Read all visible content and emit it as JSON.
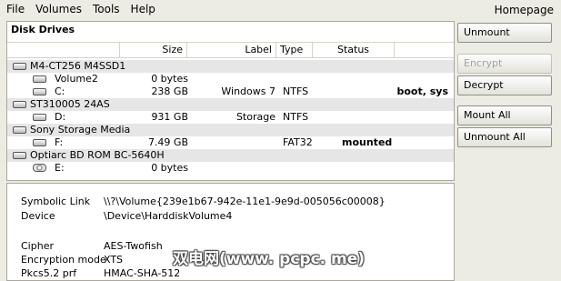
{
  "menubar": {
    "file": "File",
    "volumes": "Volumes",
    "tools": "Tools",
    "help": "Help",
    "homepage": "Homepage"
  },
  "drives": {
    "title": "Disk Drives",
    "columns": {
      "size": "Size",
      "label": "Label",
      "type": "Type",
      "status": "Status"
    },
    "rows": [
      {
        "kind": "disk",
        "name": "M4-CT256 M4SSD1",
        "size": "",
        "label": "",
        "type": "",
        "status": "",
        "extra": "",
        "icon": "harddisk-icon"
      },
      {
        "kind": "vol",
        "name": "Volume2",
        "size": "0 bytes",
        "label": "",
        "type": "",
        "status": "",
        "extra": "",
        "icon": "volume-icon"
      },
      {
        "kind": "vol",
        "name": "C:",
        "size": "238 GB",
        "label": "Windows 7",
        "type": "NTFS",
        "status": "",
        "extra": "boot, sys",
        "icon": "volume-icon"
      },
      {
        "kind": "disk",
        "name": "ST310005 24AS",
        "size": "",
        "label": "",
        "type": "",
        "status": "",
        "extra": "",
        "icon": "harddisk-icon"
      },
      {
        "kind": "vol",
        "name": "D:",
        "size": "931 GB",
        "label": "Storage",
        "type": "NTFS",
        "status": "",
        "extra": "",
        "icon": "volume-icon"
      },
      {
        "kind": "disk",
        "name": "Sony Storage Media",
        "size": "",
        "label": "",
        "type": "",
        "status": "",
        "extra": "",
        "icon": "harddisk-icon"
      },
      {
        "kind": "vol",
        "name": "F:",
        "size": "7.49 GB",
        "label": "",
        "type": "FAT32",
        "status": "mounted",
        "extra": "",
        "icon": "volume-icon"
      },
      {
        "kind": "disk",
        "name": "Optiarc BD ROM BC-5640H",
        "size": "",
        "label": "",
        "type": "",
        "status": "",
        "extra": "",
        "icon": "harddisk-icon"
      },
      {
        "kind": "vol",
        "name": "E:",
        "size": "0 bytes",
        "label": "",
        "type": "",
        "status": "",
        "extra": "",
        "icon": "cdrom-icon"
      }
    ]
  },
  "details": {
    "symbolic_link_key": "Symbolic Link",
    "symbolic_link_val": "\\\\?\\Volume{239e1b67-942e-11e1-9e9d-005056c00008}",
    "device_key": "Device",
    "device_val": "\\Device\\HarddiskVolume4",
    "cipher_key": "Cipher",
    "cipher_val": "AES-Twofish",
    "encmode_key": "Encryption mode",
    "encmode_val": "XTS",
    "prf_key": "Pkcs5.2 prf",
    "prf_val": "HMAC-SHA-512"
  },
  "watermark": "双电网(www. pcpc. me)",
  "buttons": {
    "unmount": "Unmount",
    "encrypt": "Encrypt",
    "decrypt": "Decrypt",
    "mount_all": "Mount All",
    "unmount_all": "Unmount All"
  }
}
